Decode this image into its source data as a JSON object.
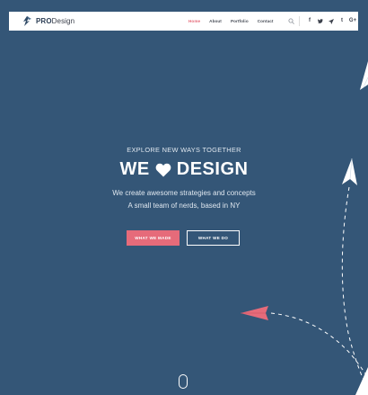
{
  "brand": {
    "strong": "PRO",
    "light": "Design"
  },
  "nav": [
    {
      "label": "Home",
      "active": true
    },
    {
      "label": "About",
      "active": false
    },
    {
      "label": "Portfolio",
      "active": false
    },
    {
      "label": "Contact",
      "active": false
    }
  ],
  "header_icons": [
    "search-icon",
    "facebook-icon",
    "twitter-icon",
    "send-icon",
    "tumblr-icon",
    "google-plus-icon"
  ],
  "social": {
    "facebook": "f",
    "tumblr": "t",
    "google_plus": "G+"
  },
  "hero": {
    "eyebrow": "EXPLORE NEW WAYS TOGETHER",
    "title_left": "WE",
    "title_right": "DESIGN",
    "line1": "We create awesome strategies and concepts",
    "line2": "A small team of nerds, based in NY"
  },
  "buttons": {
    "primary": "WHAT WE MADE",
    "secondary": "WHAT WE DO"
  },
  "colors": {
    "background": "#345677",
    "accent": "#e66b7a",
    "header_bg": "#ffffff",
    "text_light": "#dfe7ef"
  },
  "decorations": [
    "paper-plane-white",
    "paper-plane-white",
    "paper-plane-pink",
    "dashed-trail",
    "scroll-mouse-icon"
  ]
}
